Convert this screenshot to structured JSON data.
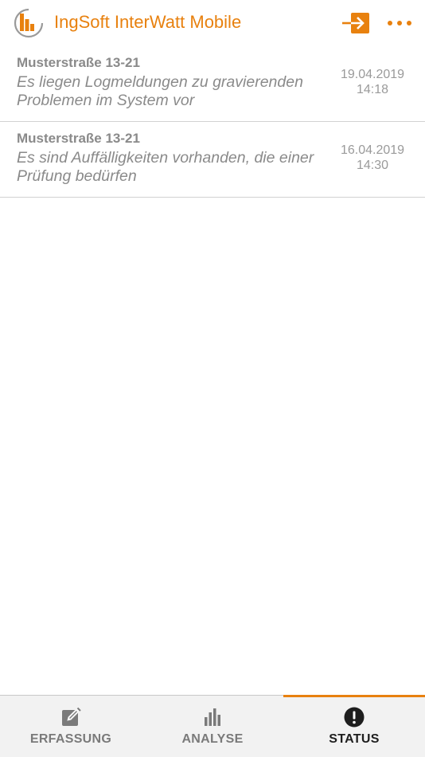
{
  "header": {
    "title": "IngSoft InterWatt Mobile",
    "logo_icon": "ingsoft-logo-icon",
    "login_icon": "login-arrow-icon",
    "more_icon": "more-dots-icon"
  },
  "colors": {
    "accent": "#e8810f",
    "text_gray": "#8a8a8a",
    "divider": "#d2d2d2",
    "nav_bg": "#f2f2f2"
  },
  "messages": [
    {
      "location": "Musterstraße 13-21",
      "text": "Es liegen Logmeldungen zu gravierenden Problemen im System vor",
      "date": "19.04.2019",
      "time": "14:18"
    },
    {
      "location": "Musterstraße 13-21",
      "text": "Es sind Auffälligkeiten vorhanden, die einer Prüfung bedürfen",
      "date": "16.04.2019",
      "time": "14:30"
    }
  ],
  "nav": {
    "tabs": [
      {
        "label": "ERFASSUNG",
        "icon": "edit-icon",
        "active": false
      },
      {
        "label": "ANALYSE",
        "icon": "bar-chart-icon",
        "active": false
      },
      {
        "label": "STATUS",
        "icon": "exclamation-circle-icon",
        "active": true
      }
    ]
  }
}
